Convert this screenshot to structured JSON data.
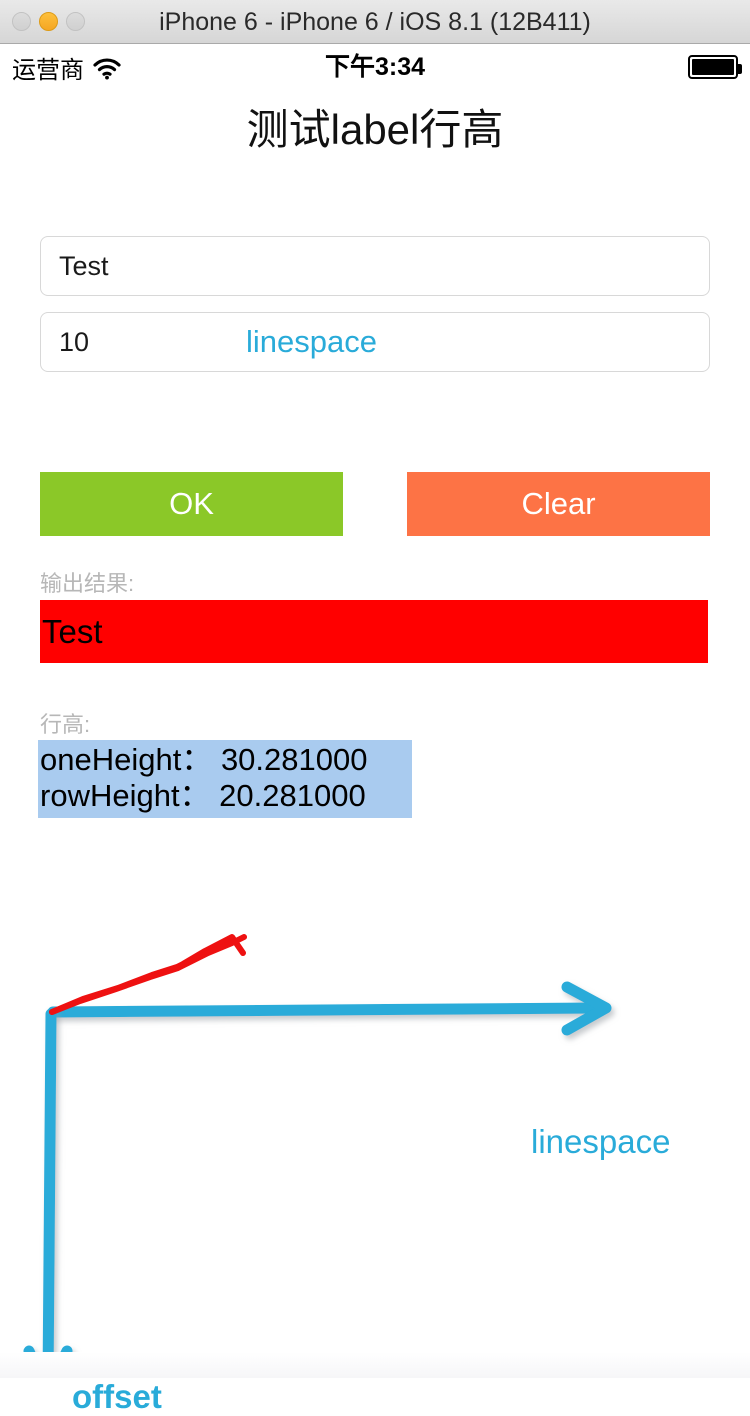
{
  "window": {
    "title": "iPhone 6 - iPhone 6 / iOS 8.1 (12B411)",
    "traffic_lights": [
      {
        "name": "close",
        "state": "inactive"
      },
      {
        "name": "minimize",
        "state": "amber"
      },
      {
        "name": "zoom",
        "state": "inactive"
      }
    ]
  },
  "status_bar": {
    "carrier": "运营商",
    "wifi_icon": "wifi-icon",
    "time": "下午3:34",
    "battery_icon": "battery-full-icon"
  },
  "app": {
    "title": "测试label行高",
    "fields": {
      "text": {
        "value": "Test",
        "placeholder": "Test"
      },
      "linespace": {
        "value": "10",
        "placeholder": "10",
        "label": "linespace"
      }
    },
    "buttons": {
      "ok": "OK",
      "clear": "Clear"
    },
    "output": {
      "caption": "输出结果:",
      "text": "Test",
      "background": "#ff0000"
    },
    "line_height": {
      "caption": "行高:",
      "rows": [
        "oneHeight： 30.281000",
        "rowHeight： 20.281000"
      ],
      "background": "#a9cbef"
    },
    "annotations": {
      "arrow_right_label": "linespace",
      "arrow_down_label": "offset",
      "arrow_color": "#29abd9",
      "freehand_color": "#ee1111"
    }
  }
}
